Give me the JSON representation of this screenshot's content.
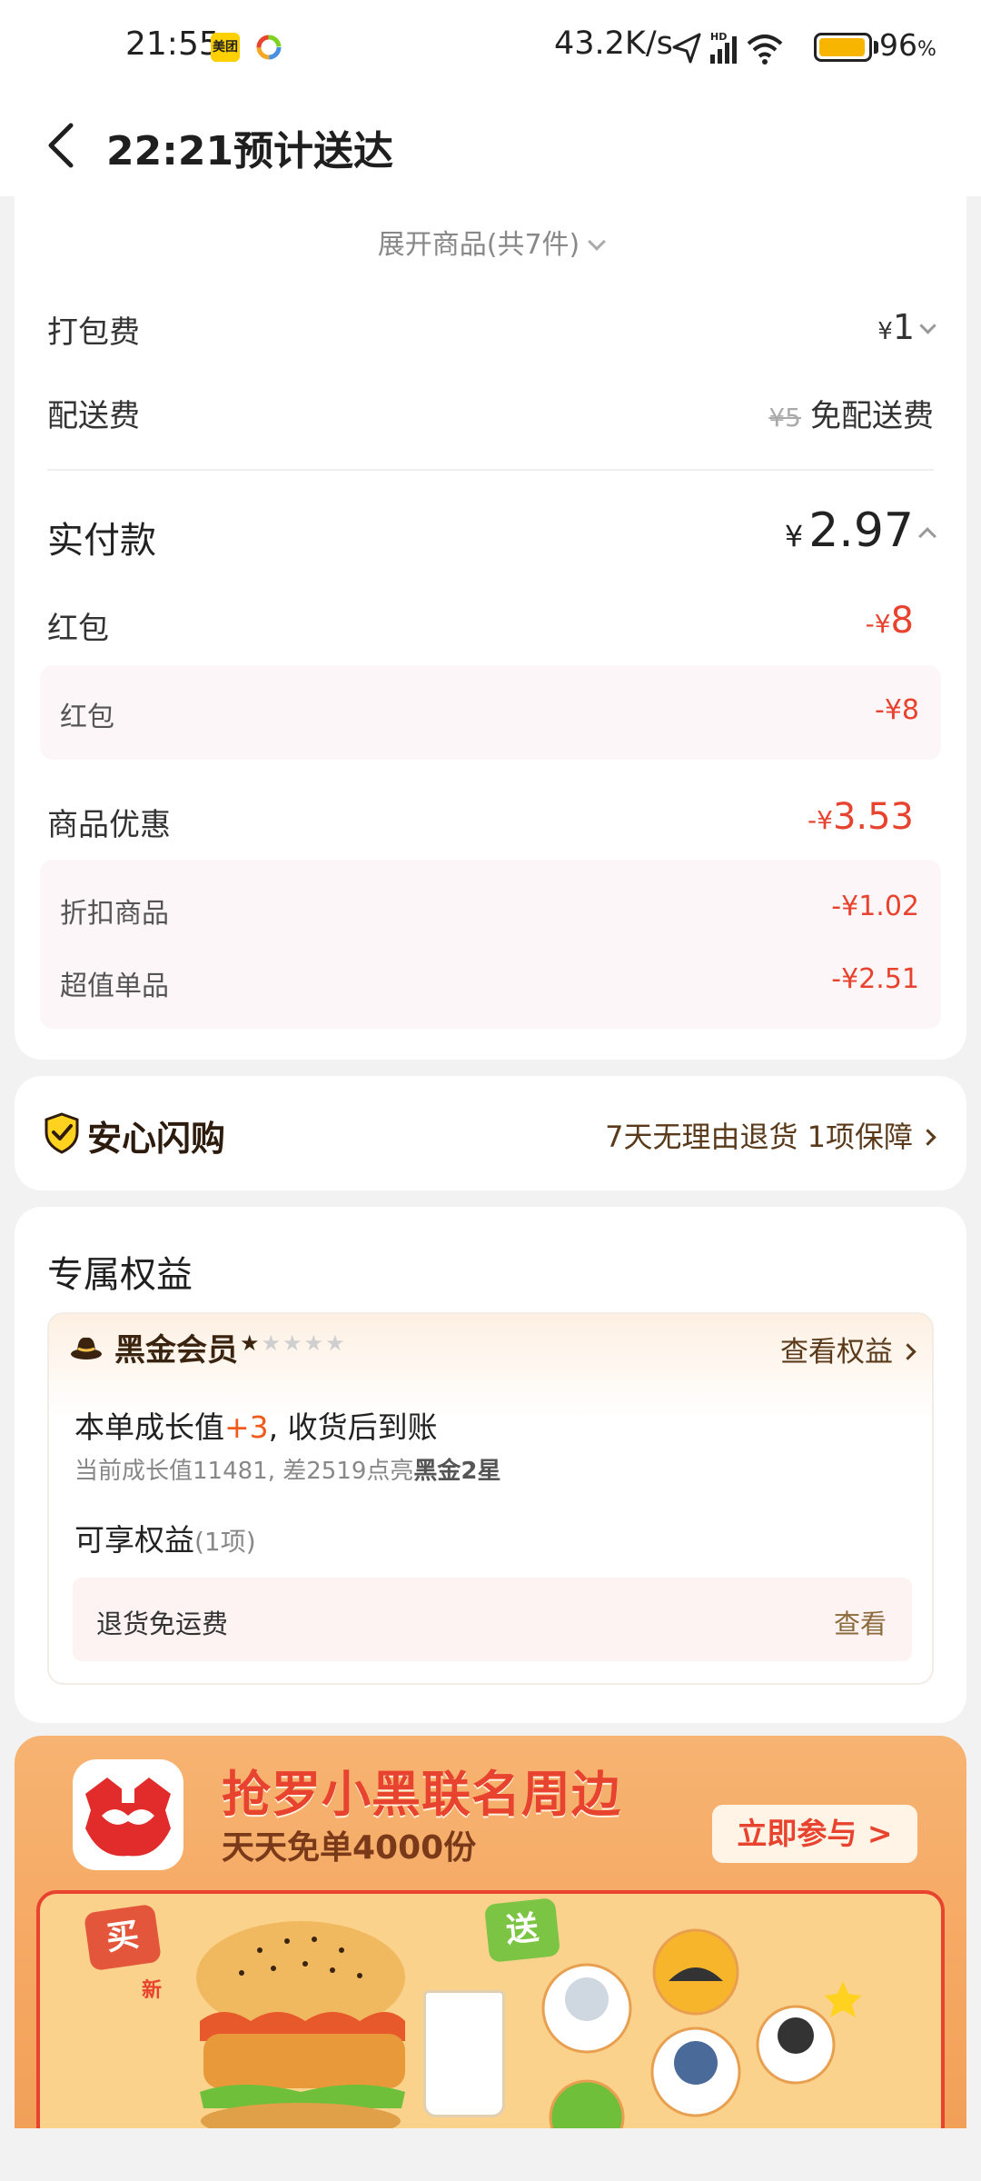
{
  "status_bar": {
    "time": "21:55",
    "app_icon_1": "美团",
    "net_speed": "43.2K/s",
    "battery_pct": "96",
    "battery_unit": "%",
    "battery_level": 0.96,
    "icons": [
      "meituan-app-icon",
      "colorful-app-icon",
      "location-arrow-icon",
      "hd-signal-icon",
      "wifi-icon",
      "battery-icon"
    ]
  },
  "header": {
    "title": "22:21预计送达",
    "back_icon": "back-arrow-icon"
  },
  "order": {
    "expand_label": "展开商品(共7件)",
    "packing_fee_label": "打包费",
    "packing_fee_currency": "¥",
    "packing_fee_value": "1",
    "delivery_fee_label": "配送费",
    "delivery_fee_original": "¥5",
    "delivery_fee_note": "免配送费",
    "paid_label": "实付款",
    "paid_currency": "¥",
    "paid_value": "2.97",
    "red_packet_label": "红包",
    "red_packet_prefix": "-¥",
    "red_packet_value": "8",
    "red_packet_items": [
      {
        "label": "红包",
        "value": "-¥8"
      }
    ],
    "discount_label": "商品优惠",
    "discount_prefix": "-¥",
    "discount_value": "3.53",
    "discount_items": [
      {
        "label": "折扣商品",
        "value": "-¥1.02"
      },
      {
        "label": "超值单品",
        "value": "-¥2.51"
      }
    ]
  },
  "guarantee": {
    "title": "安心闪购",
    "detail": "7天无理由退货 1项保障"
  },
  "exclusive": {
    "title": "专属权益",
    "member_name": "黑金会员",
    "member_stars_filled": 1,
    "member_stars_total": 5,
    "member_link": "查看权益",
    "growth_prefix": "本单成长值",
    "growth_plus": "+3",
    "growth_suffix": ", 收货后到账",
    "growth_sub_prefix": "当前成长值11481, 差2519点亮",
    "growth_sub_bold": "黑金2星",
    "perks_title": "可享权益",
    "perks_count": "(1项)",
    "perk_name": "退货免运费",
    "perk_link": "查看"
  },
  "banner": {
    "title": "抢罗小黑联名周边",
    "subtitle": "天天免单4000份",
    "button": "立即参与 >",
    "tag_buy": "买",
    "tag_send": "送",
    "new_tag": "新"
  },
  "colors": {
    "accent_red": "#e8432e",
    "brown": "#5a3a1a",
    "banner_orange": "#f5a862",
    "battery_yellow": "#f7b500"
  }
}
